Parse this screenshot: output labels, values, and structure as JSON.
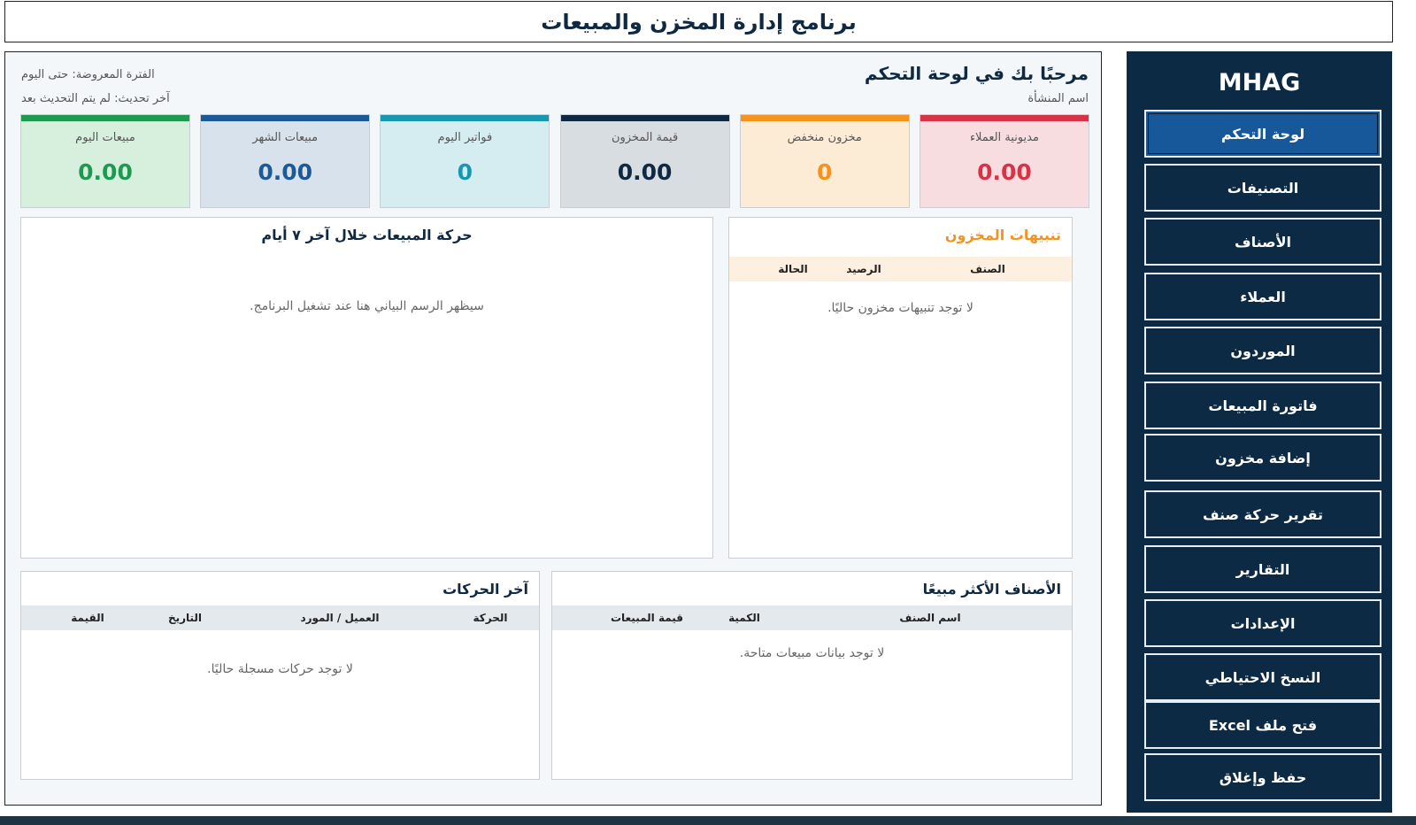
{
  "window": {
    "title": "برنامج إدارة المخزن والمبيعات"
  },
  "header": {
    "welcome": "مرحبًا بك في لوحة التحكم",
    "company_label": "اسم المنشأة",
    "period": "الفترة المعروضة: حتى اليوم",
    "last_update": "آخر تحديث: لم يتم التحديث بعد"
  },
  "kpis": [
    {
      "label": "مديونية العملاء",
      "value": "0.00",
      "color": "#d63346",
      "bg": "#f8dde0"
    },
    {
      "label": "مخزون منخفض",
      "value": "0",
      "color": "#f5931e",
      "bg": "#fdecd5"
    },
    {
      "label": "قيمة المخزون",
      "value": "0.00",
      "color": "#0f2942",
      "bg": "#d8dde1"
    },
    {
      "label": "فواتير اليوم",
      "value": "0",
      "color": "#1897b0",
      "bg": "#d5edf1"
    },
    {
      "label": "مبيعات الشهر",
      "value": "0.00",
      "color": "#1c5a97",
      "bg": "#d7e2ec"
    },
    {
      "label": "مبيعات اليوم",
      "value": "0.00",
      "color": "#1d9950",
      "bg": "#d7f0de"
    }
  ],
  "stock_alerts": {
    "title": "تنبيهات المخزون",
    "title_color": "#f5931e",
    "columns": [
      "الصنف",
      "الرصيد",
      "الحالة"
    ],
    "empty": "لا توجد تنبيهات مخزون حاليًا."
  },
  "sales_chart": {
    "title": "حركة المبيعات خلال آخر ٧ أيام",
    "placeholder": "سيظهر الرسم البياني هنا عند تشغيل البرنامج."
  },
  "top_items": {
    "title": "الأصناف الأكثر مبيعًا",
    "columns": [
      "اسم الصنف",
      "الكمية",
      "قيمة المبيعات"
    ],
    "empty": "لا توجد بيانات مبيعات متاحة."
  },
  "recent_moves": {
    "title": "آخر الحركات",
    "columns": [
      "الحركة",
      "العميل / المورد",
      "التاريخ",
      "القيمة"
    ],
    "empty": "لا توجد حركات مسجلة حاليًا."
  },
  "sidebar": {
    "logo": "MHAG",
    "items": [
      {
        "label": "لوحة التحكم",
        "active": true
      },
      {
        "label": "التصنيفات"
      },
      {
        "label": "الأصناف"
      },
      {
        "label": "العملاء"
      },
      {
        "label": "الموردون"
      },
      {
        "label": "فاتورة المبيعات"
      },
      {
        "label": "إضافة مخزون"
      },
      {
        "label": "تقرير حركة صنف"
      },
      {
        "label": "التقارير"
      },
      {
        "label": "الإعدادات"
      },
      {
        "label": "النسخ الاحتياطي"
      },
      {
        "label": "فتح ملف Excel"
      },
      {
        "label": "حفظ وإغلاق"
      }
    ]
  }
}
